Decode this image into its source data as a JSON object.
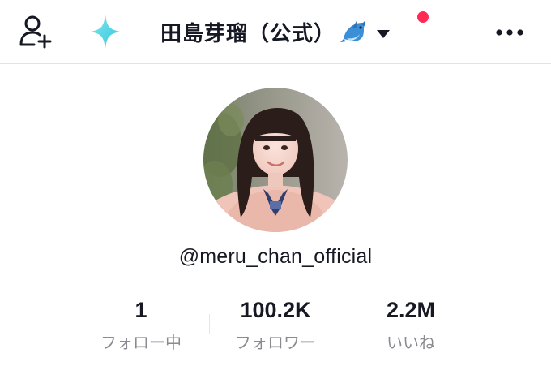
{
  "header": {
    "title": "田島芽瑠（公式）",
    "icons": {
      "add_friend": "add-friend-icon",
      "sparkle": "sparkle-icon",
      "title_emoji": "dolphin-icon",
      "dropdown": "caret-down-icon",
      "more": "more-icon"
    },
    "has_notification": true
  },
  "profile": {
    "username": "@meru_chan_official"
  },
  "stats": [
    {
      "value": "1",
      "label": "フォロー中"
    },
    {
      "value": "100.2K",
      "label": "フォロワー"
    },
    {
      "value": "2.2M",
      "label": "いいね"
    }
  ],
  "colors": {
    "text": "#161823",
    "secondary_text": "#8a8b91",
    "notification_dot": "#fe2c55",
    "sparkle": "#5ad7e6",
    "divider": "#e3e3e4"
  }
}
